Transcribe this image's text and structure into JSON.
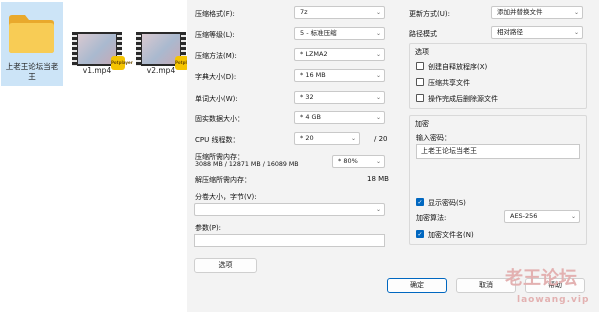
{
  "explorer": {
    "files": [
      {
        "name": "上老王论坛当老王",
        "kind": "folder",
        "selected": true
      },
      {
        "name": "v1.mp4",
        "kind": "video"
      },
      {
        "name": "v2.mp4",
        "kind": "video"
      }
    ],
    "badge_text": "Potplayer"
  },
  "dialog": {
    "archive_format": {
      "label": "压缩格式(F):",
      "value": "7z"
    },
    "compression_level": {
      "label": "压缩等级(L):",
      "value": "5 - 标准压缩"
    },
    "compression_method": {
      "label": "压缩方法(M):",
      "value": "* LZMA2"
    },
    "dictionary_size": {
      "label": "字典大小(D):",
      "value": "* 16 MB"
    },
    "word_size": {
      "label": "单词大小(W):",
      "value": "* 32"
    },
    "solid_block_size": {
      "label": "固实数据大小：",
      "value": "* 4 GB"
    },
    "cpu_threads": {
      "label": "CPU 线程数：",
      "value": "* 20",
      "total": "/ 20"
    },
    "memory_compress": {
      "label": "压缩所需内存：",
      "detail": "3088 MB / 12871 MB / 16089 MB",
      "value": "* 80%"
    },
    "memory_decompress": {
      "label": "解压缩所需内存：",
      "value": "18 MB"
    },
    "split_volume": {
      "label": "分卷大小，字节(V):",
      "value": ""
    },
    "parameters": {
      "label": "参数(P):",
      "value": ""
    },
    "options_button": "选项",
    "update_mode": {
      "label": "更新方式(U):",
      "value": "添加并替换文件"
    },
    "path_mode": {
      "label": "路径模式",
      "value": "相对路径"
    },
    "options_group": {
      "title": "选项",
      "items": [
        {
          "label": "创建自释放程序(X)",
          "checked": false
        },
        {
          "label": "压缩共享文件",
          "checked": false
        },
        {
          "label": "操作完成后删除源文件",
          "checked": false
        }
      ]
    },
    "encryption_group": {
      "title": "加密",
      "password_label": "输入密码：",
      "password_value": "上老王论坛当老王",
      "show_password": {
        "label": "显示密码(S)",
        "checked": true
      },
      "method_label": "加密算法:",
      "method_value": "AES-256",
      "encrypt_names": {
        "label": "加密文件名(N)",
        "checked": true
      }
    },
    "ok_button": "确定",
    "cancel_button": "取消",
    "help_button": "帮助"
  },
  "watermark": {
    "title": "老王论坛",
    "url": "laowang.vip"
  },
  "colors": {
    "accent": "#0067c0",
    "selection": "#cce4f7",
    "watermark": "#e3b1b1",
    "folder": "#f4c542"
  }
}
